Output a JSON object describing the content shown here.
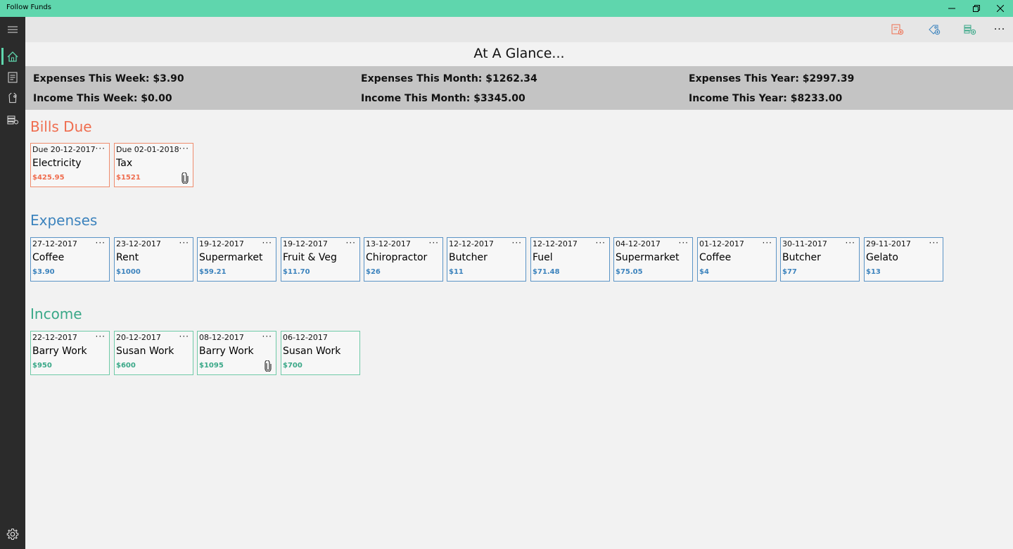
{
  "window": {
    "title": "Follow Funds"
  },
  "page": {
    "title": "At A Glance..."
  },
  "summary": {
    "expenses_week": "Expenses This Week: $3.90",
    "income_week": "Income This Week: $0.00",
    "expenses_month": "Expenses This Month: $1262.34",
    "income_month": "Income This Month: $3345.00",
    "expenses_year": "Expenses This Year: $2997.39",
    "income_year": "Income This Year: $8233.00"
  },
  "colors": {
    "accent": "#5fd6ad",
    "bills": "#ef6d4f",
    "expenses": "#3c83bd",
    "income": "#3aa888"
  },
  "sections": {
    "bills": {
      "heading": "Bills Due"
    },
    "expenses": {
      "heading": "Expenses"
    },
    "income": {
      "heading": "Income"
    }
  },
  "bills": [
    {
      "date": "Due 20-12-2017",
      "name": "Electricity",
      "amount": "$425.95",
      "more": "···"
    },
    {
      "date": "Due 02-01-2018",
      "name": "Tax",
      "amount": "$1521",
      "more": "···"
    }
  ],
  "expenses": [
    {
      "date": "27-12-2017",
      "name": "Coffee",
      "amount": "$3.90",
      "more": "···"
    },
    {
      "date": "23-12-2017",
      "name": "Rent",
      "amount": "$1000",
      "more": "···"
    },
    {
      "date": "19-12-2017",
      "name": "Supermarket",
      "amount": "$59.21",
      "more": "···"
    },
    {
      "date": "19-12-2017",
      "name": "Fruit & Veg",
      "amount": "$11.70",
      "more": "···"
    },
    {
      "date": "13-12-2017",
      "name": "Chiropractor",
      "amount": "$26",
      "more": "···"
    },
    {
      "date": "12-12-2017",
      "name": "Butcher",
      "amount": "$11",
      "more": "···"
    },
    {
      "date": "12-12-2017",
      "name": "Fuel",
      "amount": "$71.48",
      "more": "···"
    },
    {
      "date": "04-12-2017",
      "name": "Supermarket",
      "amount": "$75.05",
      "more": "···"
    },
    {
      "date": "01-12-2017",
      "name": "Coffee",
      "amount": "$4",
      "more": "···"
    },
    {
      "date": "30-11-2017",
      "name": "Butcher",
      "amount": "$77",
      "more": "···"
    },
    {
      "date": "29-11-2017",
      "name": "Gelato",
      "amount": "$13",
      "more": "···"
    }
  ],
  "income": [
    {
      "date": "22-12-2017",
      "name": "Barry Work",
      "amount": "$950",
      "more": "···"
    },
    {
      "date": "20-12-2017",
      "name": "Susan Work",
      "amount": "$600",
      "more": "···"
    },
    {
      "date": "08-12-2017",
      "name": "Barry Work",
      "amount": "$1095",
      "more": "···"
    },
    {
      "date": "06-12-2017",
      "name": "Susan Work",
      "amount": "$700"
    }
  ],
  "commandbar": {
    "more_label": "···"
  },
  "icons": {
    "sidebar": [
      "hamburger-icon",
      "home-icon",
      "bill-icon",
      "tag-icon",
      "income-icon",
      "gear-icon"
    ],
    "commandbar": [
      "add-bill-icon",
      "add-expense-icon",
      "add-income-icon",
      "more-icon"
    ],
    "attachment": "paperclip-icon"
  }
}
